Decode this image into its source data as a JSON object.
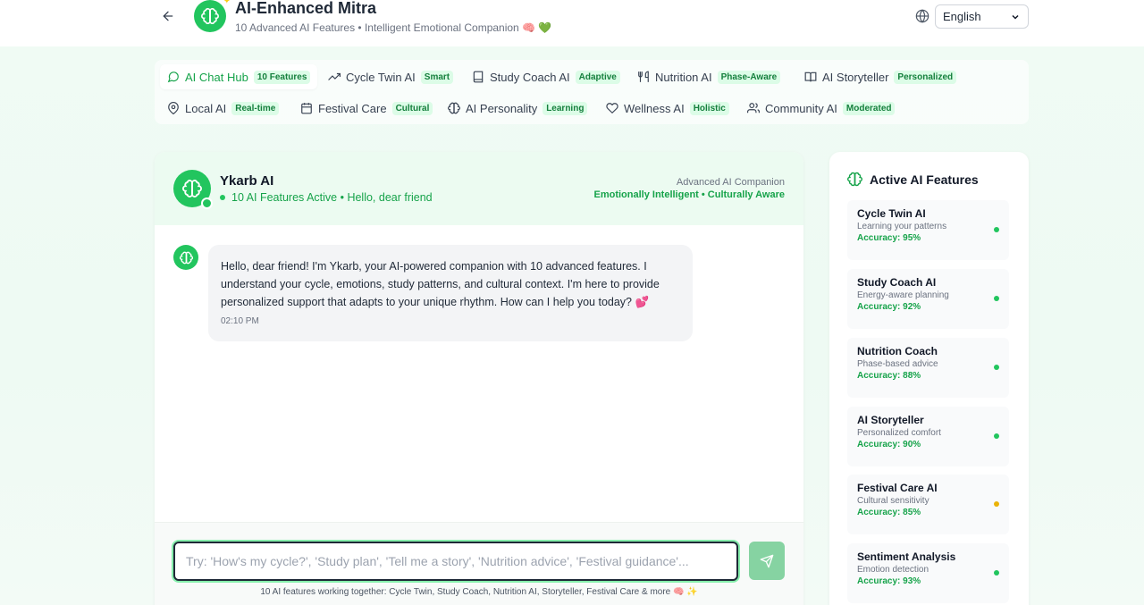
{
  "header": {
    "title": "AI-Enhanced Mitra",
    "subtitle": "10 Advanced AI Features • Intelligent Emotional Companion 🧠 💚",
    "language": "English"
  },
  "nav": {
    "items": [
      {
        "label": "AI Chat Hub",
        "badge": "10 Features",
        "icon": "message-circle-icon"
      },
      {
        "label": "Cycle Twin AI",
        "badge": "Smart",
        "icon": "trending-up-icon"
      },
      {
        "label": "Study Coach AI",
        "badge": "Adaptive",
        "icon": "book-icon"
      },
      {
        "label": "Nutrition AI",
        "badge": "Phase-Aware",
        "icon": "utensils-icon"
      },
      {
        "label": "AI Storyteller",
        "badge": "Personalized",
        "icon": "open-book-icon"
      },
      {
        "label": "Local AI",
        "badge": "Real-time",
        "icon": "map-pin-icon"
      },
      {
        "label": "Festival Care",
        "badge": "Cultural",
        "icon": "calendar-icon"
      },
      {
        "label": "AI Personality",
        "badge": "Learning",
        "icon": "brain-icon"
      },
      {
        "label": "Wellness AI",
        "badge": "Holistic",
        "icon": "heart-icon"
      },
      {
        "label": "Community AI",
        "badge": "Moderated",
        "icon": "users-icon"
      }
    ]
  },
  "chat": {
    "bot_name": "Ykarb AI",
    "status": "10 AI Features Active • Hello, dear friend",
    "companion_title": "Advanced AI Companion",
    "companion_sub": "Emotionally Intelligent • Culturally Aware",
    "message": "Hello, dear friend! I'm Ykarb, your AI-powered companion with 10 advanced features. I understand your cycle, emotions, study patterns, and cultural context. I'm here to provide personalized support that adapts to your unique rhythm. How can I help you today? 💕",
    "message_time": "02:10 PM",
    "input_placeholder": "Try: 'How's my cycle?', 'Study plan', 'Tell me a story', 'Nutrition advice', 'Festival guidance'...",
    "footer_note": "10 AI features working together: Cycle Twin, Study Coach, Nutrition AI, Storyteller, Festival Care & more 🧠 ✨"
  },
  "side": {
    "title": "Active AI Features",
    "features": [
      {
        "name": "Cycle Twin AI",
        "desc": "Learning your patterns",
        "accuracy": "Accuracy: 95%",
        "status_color": "#22c55e"
      },
      {
        "name": "Study Coach AI",
        "desc": "Energy-aware planning",
        "accuracy": "Accuracy: 92%",
        "status_color": "#22c55e"
      },
      {
        "name": "Nutrition Coach",
        "desc": "Phase-based advice",
        "accuracy": "Accuracy: 88%",
        "status_color": "#22c55e"
      },
      {
        "name": "AI Storyteller",
        "desc": "Personalized comfort",
        "accuracy": "Accuracy: 90%",
        "status_color": "#22c55e"
      },
      {
        "name": "Festival Care AI",
        "desc": "Cultural sensitivity",
        "accuracy": "Accuracy: 85%",
        "status_color": "#eab308"
      },
      {
        "name": "Sentiment Analysis",
        "desc": "Emotion detection",
        "accuracy": "Accuracy: 93%",
        "status_color": "#22c55e"
      }
    ]
  },
  "colors": {
    "accent": "#22c55e",
    "accent_dark": "#16a34a",
    "badge_bg": "#dcfce7"
  }
}
